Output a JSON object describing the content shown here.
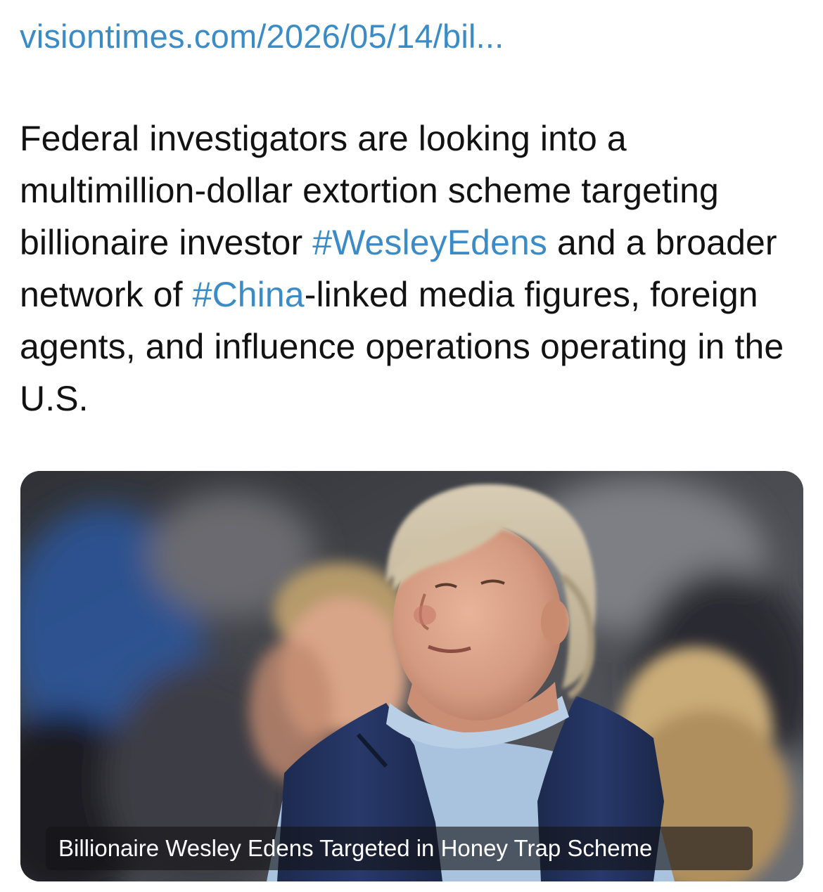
{
  "link": {
    "url_text": "visiontimes.com/2026/05/14/bil..."
  },
  "post": {
    "segments": [
      "Federal investigators are looking into a multimillion-dollar extortion scheme targeting billionaire investor ",
      "#WesleyEdens",
      " and a broader network of ",
      "#China",
      "-linked media figures, foreign agents, and influence operations operating in the U.S."
    ]
  },
  "card": {
    "caption": "Billionaire Wesley Edens Targeted in Honey Trap Scheme"
  },
  "colors": {
    "link": "#3b8bc6",
    "text": "#121212",
    "background": "#ffffff"
  }
}
